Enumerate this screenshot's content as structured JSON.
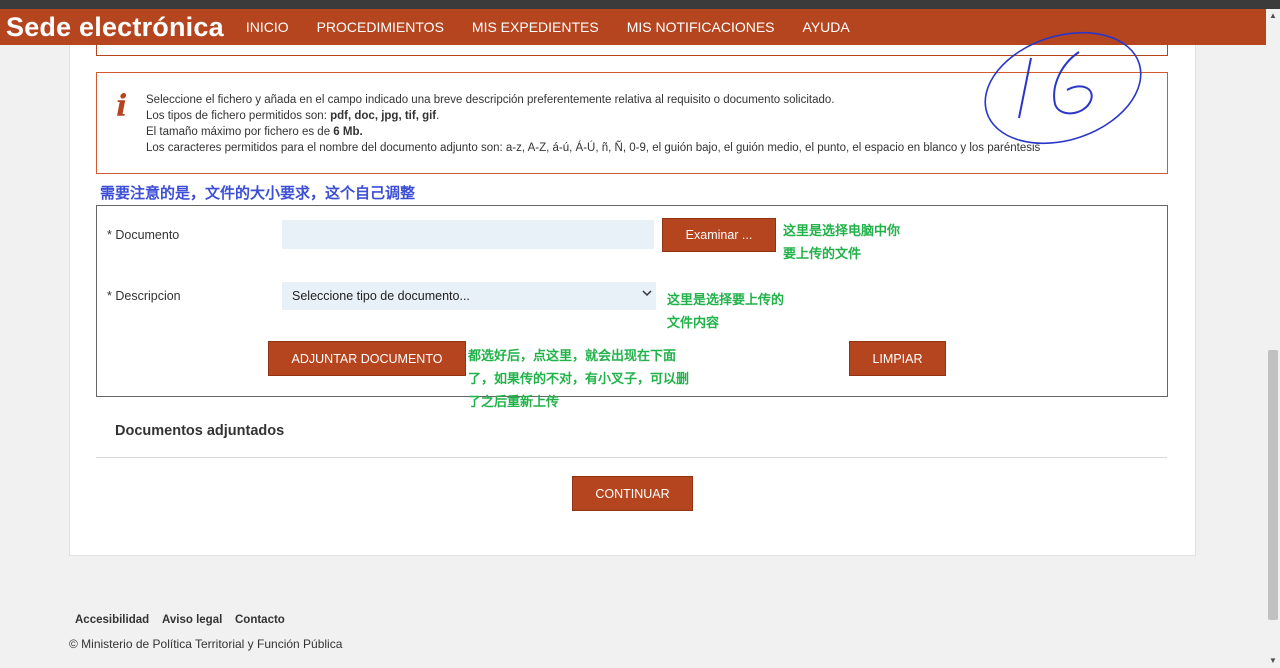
{
  "nav": {
    "brand": "Sede electrónica",
    "links": [
      "INICIO",
      "PROCEDIMIENTOS",
      "MIS EXPEDIENTES",
      "MIS NOTIFICACIONES",
      "AYUDA"
    ]
  },
  "info": {
    "line1": "Seleccione el fichero y añada en el campo indicado una breve descripción preferentemente relativa al requisito o documento solicitado.",
    "line2_prefix": "Los tipos de fichero permitidos son: ",
    "line2_types": "pdf, doc, jpg, tif, gif",
    "line2_suffix": ".",
    "line3_prefix": "El tamaño máximo por fichero es de ",
    "line3_size": "6 Mb.",
    "line4": "Los caracteres permitidos para el nombre del documento adjunto son: a-z, A-Z, á-ú, Á-Ú, ñ, Ñ, 0-9, el guión bajo, el guión medio, el punto, el espacio en blanco y los paréntesis"
  },
  "annotations": {
    "blue_note": "需要注意的是，文件的大小要求，这个自己调整",
    "examinar_note": [
      "这里是选择电脑中你",
      "要上传的文件"
    ],
    "descripcion_note": [
      "这里是选择要上传的",
      "文件内容"
    ],
    "adjuntar_note": [
      "都选好后，点这里，就会出现在下面",
      "了，如果传的不对，有小叉子，可以删",
      "了之后重新上传"
    ],
    "handwritten_number": "16"
  },
  "form": {
    "documento_label": "* Documento",
    "file_value": "",
    "examinar_label": "Examinar ...",
    "descripcion_label": "* Descripcion",
    "select_value": "Seleccione tipo de documento...",
    "adjuntar_label": "ADJUNTAR DOCUMENTO",
    "limpiar_label": "LIMPIAR"
  },
  "attached": {
    "title": "Documentos adjuntados"
  },
  "continue_label": "CONTINUAR",
  "footer": {
    "links": [
      "Accesibilidad",
      "Aviso legal",
      "Contacto"
    ],
    "copyright": "© Ministerio de Política Territorial y Función Pública"
  },
  "colors": {
    "brand": "#b5451f",
    "annotation_green": "#22b24a",
    "annotation_blue": "#3d4fd6",
    "handwriting": "#2a36c8"
  }
}
